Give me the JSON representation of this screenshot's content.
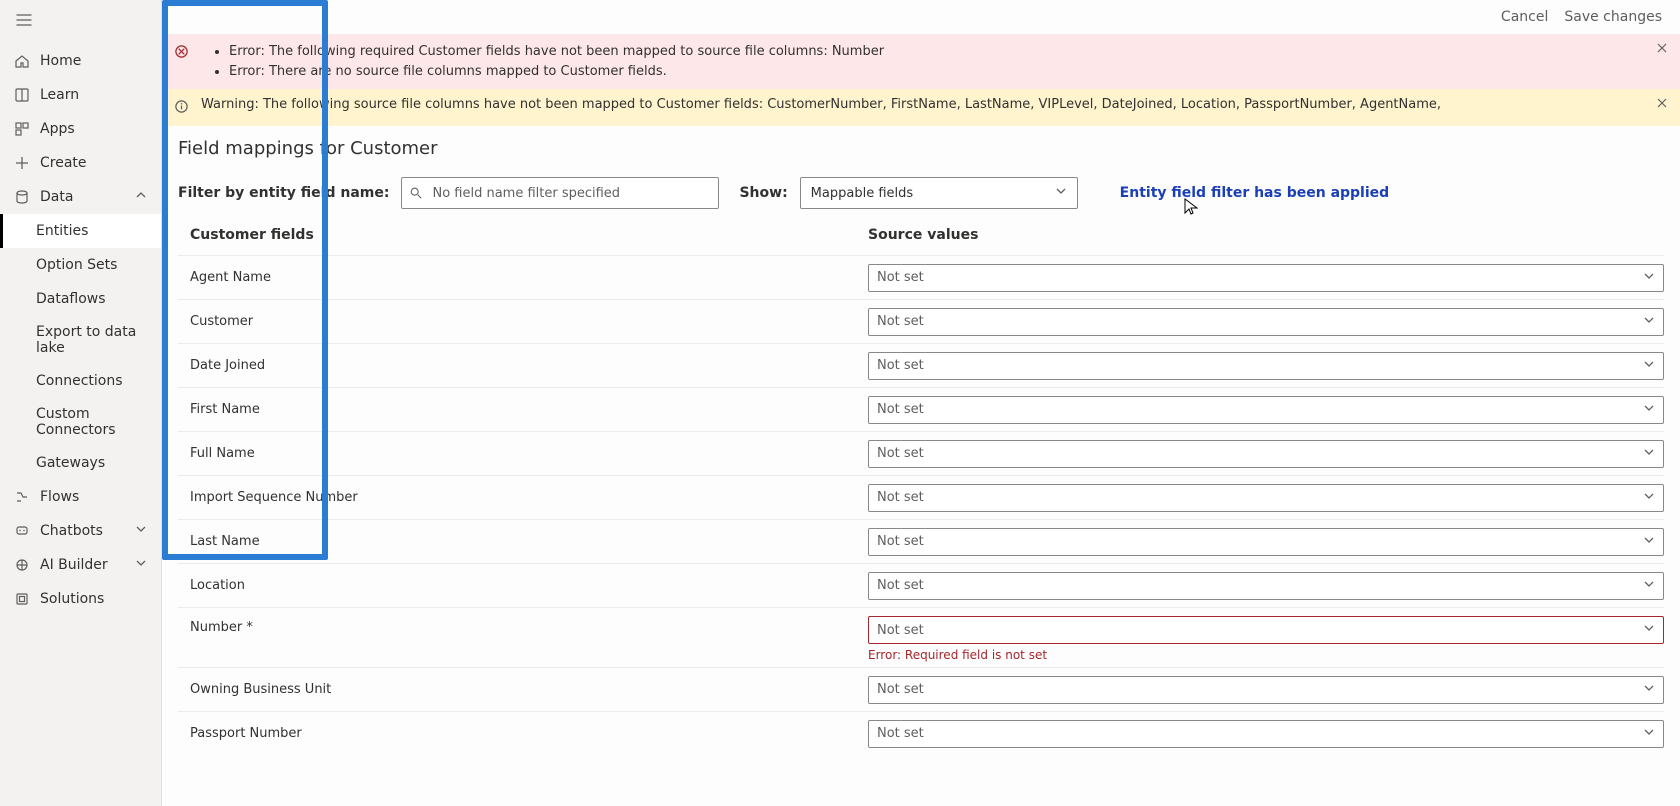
{
  "topbar": {
    "cancel": "Cancel",
    "save": "Save changes"
  },
  "sidebar": {
    "home": "Home",
    "learn": "Learn",
    "apps": "Apps",
    "create": "Create",
    "data": "Data",
    "entities": "Entities",
    "option_sets": "Option Sets",
    "dataflows": "Dataflows",
    "export": "Export to data lake",
    "connections": "Connections",
    "custom_conn": "Custom Connectors",
    "gateways": "Gateways",
    "flows": "Flows",
    "chatbots": "Chatbots",
    "ai_builder": "AI Builder",
    "solutions": "Solutions"
  },
  "alerts": {
    "err1": "Error: The following required Customer fields have not been mapped to source file columns: Number",
    "err2": "Error: There are no source file columns mapped to Customer fields.",
    "warn": "Warning: The following source file columns have not been mapped to Customer fields: CustomerNumber, FirstName, LastName, VIPLevel, DateJoined, Location, PassportNumber, AgentName,"
  },
  "page": {
    "title": "Field mappings for Customer",
    "filter_label": "Filter by entity field name:",
    "filter_placeholder": "No field name filter specified",
    "show_label": "Show:",
    "show_value": "Mappable fields",
    "filter_note": "Entity field filter has been applied"
  },
  "table": {
    "hdr_fields": "Customer fields",
    "hdr_source": "Source values",
    "notset": "Not set",
    "rows": [
      {
        "name": "Agent Name"
      },
      {
        "name": "Customer"
      },
      {
        "name": "Date Joined"
      },
      {
        "name": "First Name"
      },
      {
        "name": "Full Name"
      },
      {
        "name": "Import Sequence Number"
      },
      {
        "name": "Last Name"
      },
      {
        "name": "Location"
      },
      {
        "name": "Number *",
        "required": true,
        "error": "Error: Required field is not set"
      },
      {
        "name": "Owning Business Unit"
      },
      {
        "name": "Passport Number"
      }
    ]
  }
}
